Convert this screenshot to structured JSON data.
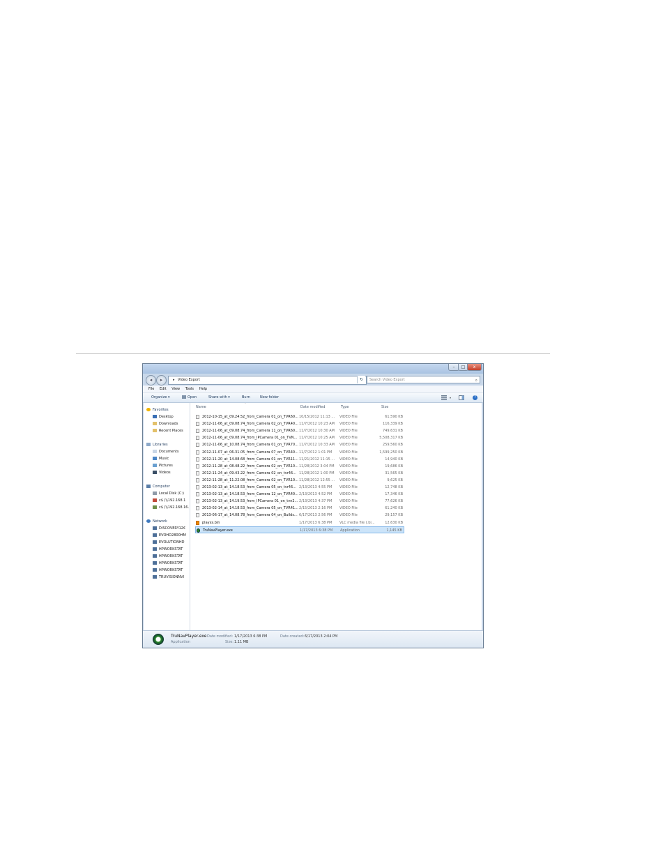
{
  "window": {
    "controls": {
      "minimize": "–",
      "maximize": "□",
      "close": "x"
    },
    "address": {
      "path": "Video Export",
      "arrow": "▸",
      "dropdown": "▾"
    },
    "refresh": "↻",
    "search_placeholder": "Search Video Export"
  },
  "menu": [
    "File",
    "Edit",
    "View",
    "Tools",
    "Help"
  ],
  "toolbar": {
    "organize": "Organize ▾",
    "open": "Open",
    "share_with": "Share with ▾",
    "burn": "Burn",
    "new_folder": "New folder",
    "help": "?"
  },
  "sidebar": {
    "favorites": {
      "label": "Favorites",
      "items": [
        "Desktop",
        "Downloads",
        "Recent Places"
      ]
    },
    "libraries": {
      "label": "Libraries",
      "items": [
        "Documents",
        "Music",
        "Pictures",
        "Videos"
      ]
    },
    "computer": {
      "label": "Computer",
      "items": [
        "Local Disk (C:)",
        "c$ (\\\\192.168.1",
        "c$ (\\\\192.168.16."
      ]
    },
    "network": {
      "label": "Network",
      "items": [
        "DISCOVERY12€",
        "EVOHD2800HM",
        "EVOLUTIONHD",
        "HPWORKSTAT",
        "HPWORKSTAT",
        "HPWORKSTAT",
        "HPWORKSTAT",
        "TRUVISIONNVI"
      ]
    }
  },
  "columns": {
    "name": "Name",
    "date": "Date modified",
    "type": "Type",
    "size": "Size"
  },
  "files": [
    {
      "name": "2012-10-15_at_09.24.52_from_Camera 01_on_TVR60...",
      "date": "10/15/2012 11:13 ...",
      "type": "VIDEO File",
      "size": "61,590 KB"
    },
    {
      "name": "2012-11-06_at_09.08.74_from_Camera 02_on_TVR40...",
      "date": "11/7/2012 10:23 AM",
      "type": "VIDEO File",
      "size": "116,339 KB"
    },
    {
      "name": "2012-11-06_at_09.08.74_from_Camera 11_on_TVR60...",
      "date": "11/7/2012 10:30 AM",
      "type": "VIDEO File",
      "size": "749,631 KB"
    },
    {
      "name": "2012-11-06_at_09.08.74_from_IPCamera 01_on_TVN...",
      "date": "11/7/2012 10:25 AM",
      "type": "VIDEO File",
      "size": "5,508,317 KB"
    },
    {
      "name": "2012-11-06_at_10.08.74_from_Camera 01_on_TVR70...",
      "date": "11/7/2012 10:33 AM",
      "type": "VIDEO File",
      "size": "259,560 KB"
    },
    {
      "name": "2012-11-07_at_06.31.05_from_Camera 07_on_TVR40...",
      "date": "11/7/2012 1:01 PM",
      "type": "VIDEO File",
      "size": "1,599,250 KB"
    },
    {
      "name": "2012-11-20_at_14.08.68_from_Camera 01_on_TVR11...",
      "date": "11/21/2012 11:15 ...",
      "type": "VIDEO File",
      "size": "14,940 KB"
    },
    {
      "name": "2012-11-28_at_08.48.22_from_Camera 02_on_TVR10...",
      "date": "11/28/2012 3:04 PM",
      "type": "VIDEO File",
      "size": "19,686 KB"
    },
    {
      "name": "2012-11-24_at_09.43.22_from_Camera 02_on_tvr46...",
      "date": "11/28/2012 1:00 PM",
      "type": "VIDEO File",
      "size": "31,565 KB"
    },
    {
      "name": "2012-11-28_at_11.22.08_from_Camera 02_on_TVR10...",
      "date": "11/28/2012 12:55 ...",
      "type": "VIDEO File",
      "size": "9,625 KB"
    },
    {
      "name": "2013-02-13_at_14.18.53_from_Camera 05_on_tvr46...",
      "date": "2/13/2013 4:55 PM",
      "type": "VIDEO File",
      "size": "12,748 KB"
    },
    {
      "name": "2013-02-13_at_14.18.53_from_Camera 12_on_TVR40...",
      "date": "2/13/2013 4:52 PM",
      "type": "VIDEO File",
      "size": "17,346 KB"
    },
    {
      "name": "2013-02-13_at_14.19.53_from_IPCamera 01_on_tvn2...",
      "date": "2/13/2013 4:37 PM",
      "type": "VIDEO File",
      "size": "77,626 KB"
    },
    {
      "name": "2013-02-14_at_14.18.53_from_Camera 05_on_TVR41...",
      "date": "2/15/2013 2:16 PM",
      "type": "VIDEO File",
      "size": "61,240 KB"
    },
    {
      "name": "2013-06-17_at_14.08.78_from_Camera 04_on_Builds...",
      "date": "6/17/2013 2:56 PM",
      "type": "VIDEO File",
      "size": "29,157 KB"
    },
    {
      "name": "playxs.bin",
      "date": "1/17/2013 6:38 PM",
      "type": "VLC media file (.bi...",
      "size": "12,630 KB"
    },
    {
      "name": "TruNavPlayer.exe",
      "date": "1/17/2013 6:38 PM",
      "type": "Application",
      "size": "1,145 KB"
    }
  ],
  "details": {
    "filename": "TruNavPlayer.exe",
    "kind": "Application",
    "modified_label": "Date modified:",
    "modified_value": "1/17/2013 6:38 PM",
    "created_label": "Date created:",
    "created_value": "6/17/2013 2:04 PM",
    "size_label": "Size:",
    "size_value": "1.11 MB"
  },
  "colors": {
    "selection": "#cce4f9",
    "selection_border": "#85b7e8",
    "title_bar": "#b7cde8"
  }
}
